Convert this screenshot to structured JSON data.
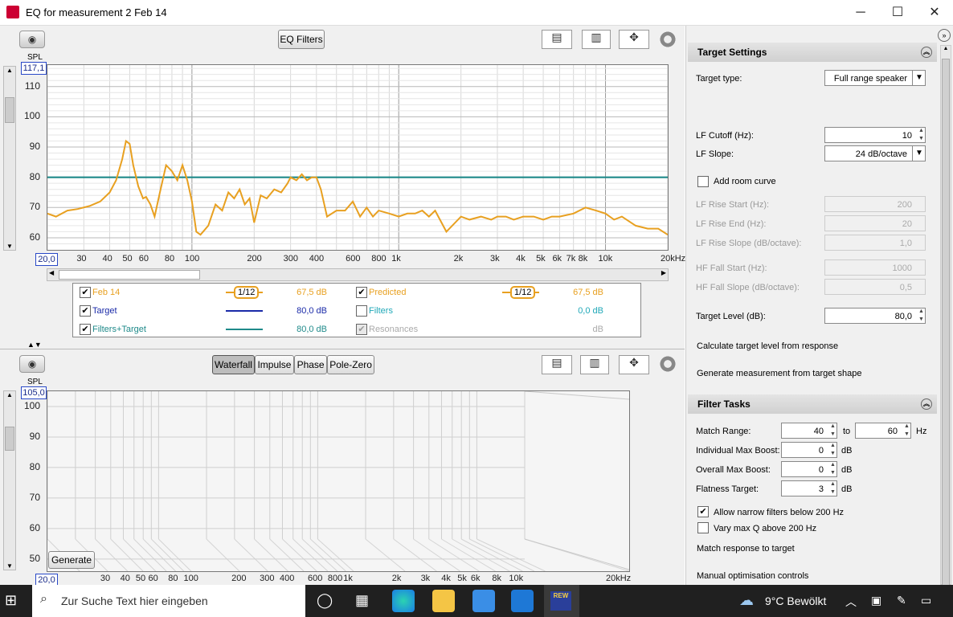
{
  "window": {
    "title": "EQ for measurement 2 Feb 14",
    "minimize": "─",
    "maximize": "☐",
    "close": "✕"
  },
  "top_graph": {
    "eq_filters_label": "EQ Filters",
    "axis_unit": "SPL",
    "y_top_value": "117,1",
    "x_left_value": "20,0",
    "y_ticks": [
      "110",
      "100",
      "90",
      "80",
      "70",
      "60"
    ],
    "x_ticks": [
      "30",
      "40",
      "50",
      "60",
      "80",
      "100",
      "200",
      "300",
      "400",
      "600",
      "800",
      "1k",
      "2k",
      "3k",
      "4k",
      "5k",
      "6k",
      "7k",
      "8k",
      "10k",
      "20kHz"
    ]
  },
  "legend": {
    "rows": [
      {
        "name": "Feb 14",
        "smoothing": "1/12",
        "value": "67,5 dB",
        "checked": true,
        "color": "#e8a020"
      },
      {
        "name": "Target",
        "value": "80,0 dB",
        "checked": true,
        "color": "#1a2aa8"
      },
      {
        "name": "Filters+Target",
        "value": "80,0 dB",
        "checked": true,
        "color": "#1f8a8a"
      }
    ],
    "rows_right": [
      {
        "name": "Predicted",
        "smoothing": "1/12",
        "value": "67,5 dB",
        "checked": true,
        "color": "#e8a020"
      },
      {
        "name": "Filters",
        "value": "0,0 dB",
        "checked": false,
        "color": "#20a8b8"
      },
      {
        "name": "Resonances",
        "value": "dB",
        "checked": true,
        "color": "#aaaaaa"
      }
    ]
  },
  "bottom_graph": {
    "tabs": [
      "Waterfall",
      "Impulse",
      "Phase",
      "Pole-Zero"
    ],
    "active_tab": "Waterfall",
    "axis_unit": "SPL",
    "y_top_value": "105,0",
    "x_left_value": "20,0",
    "y_ticks": [
      "100",
      "90",
      "80",
      "70",
      "60",
      "50"
    ],
    "x_ticks": [
      "30",
      "40",
      "50",
      "60",
      "80",
      "100",
      "200",
      "300",
      "400",
      "600",
      "800",
      "1k",
      "2k",
      "3k",
      "4k",
      "5k",
      "6k",
      "8k",
      "10k",
      "20kHz"
    ],
    "generate_label": "Generate"
  },
  "target_settings": {
    "title": "Target Settings",
    "target_type_label": "Target type:",
    "target_type_value": "Full range speaker",
    "lf_cutoff_label": "LF Cutoff (Hz):",
    "lf_cutoff_value": "10",
    "lf_slope_label": "LF Slope:",
    "lf_slope_value": "24 dB/octave",
    "add_room_curve_label": "Add room curve",
    "lf_rise_start_label": "LF Rise Start (Hz):",
    "lf_rise_start_value": "200",
    "lf_rise_end_label": "LF Rise End (Hz):",
    "lf_rise_end_value": "20",
    "lf_rise_slope_label": "LF Rise Slope (dB/octave):",
    "lf_rise_slope_value": "1,0",
    "hf_fall_start_label": "HF Fall Start (Hz):",
    "hf_fall_start_value": "1000",
    "hf_fall_slope_label": "HF Fall Slope (dB/octave):",
    "hf_fall_slope_value": "0,5",
    "target_level_label": "Target Level (dB):",
    "target_level_value": "80,0",
    "calc_target_label": "Calculate target level from response",
    "generate_meas_label": "Generate measurement from target shape"
  },
  "filter_tasks": {
    "title": "Filter Tasks",
    "match_range_label": "Match Range:",
    "match_from": "40",
    "to_label": "to",
    "match_to": "60",
    "hz_label": "Hz",
    "ind_boost_label": "Individual Max Boost:",
    "ind_boost_value": "0",
    "overall_boost_label": "Overall Max Boost:",
    "overall_boost_value": "0",
    "flatness_label": "Flatness Target:",
    "flatness_value": "3",
    "db_label": "dB",
    "allow_narrow_label": "Allow narrow filters below 200 Hz",
    "vary_q_label": "Vary max Q above 200 Hz",
    "match_response_label": "Match response to target",
    "manual_opt_label": "Manual optimisation controls"
  },
  "taskbar": {
    "search_placeholder": "Zur Suche Text hier eingeben",
    "weather": "9°C  Bewölkt",
    "rew_label": "REW"
  },
  "chart_data": {
    "type": "line",
    "xscale": "log",
    "xlim": [
      20,
      20000
    ],
    "ylim": [
      56,
      117.1
    ],
    "series": [
      {
        "name": "Target",
        "color": "#1f8a8a",
        "x": [
          20,
          20000
        ],
        "y": [
          80,
          80
        ]
      },
      {
        "name": "Predicted",
        "color": "#e8a020",
        "x": [
          20,
          22,
          25,
          28,
          32,
          36,
          40,
          43,
          46,
          48,
          50,
          52,
          55,
          58,
          60,
          63,
          66,
          70,
          75,
          80,
          85,
          90,
          95,
          100,
          105,
          110,
          120,
          130,
          140,
          150,
          160,
          170,
          180,
          190,
          200,
          215,
          230,
          250,
          270,
          290,
          300,
          320,
          340,
          360,
          380,
          400,
          420,
          450,
          500,
          550,
          600,
          650,
          700,
          750,
          800,
          900,
          1000,
          1100,
          1200,
          1300,
          1400,
          1500,
          1700,
          2000,
          2200,
          2500,
          2800,
          3000,
          3300,
          3600,
          4000,
          4500,
          5000,
          5500,
          6000,
          7000,
          8000,
          9000,
          10000,
          11000,
          12000,
          14000,
          16000,
          18000,
          20000
        ],
        "y": [
          68,
          67,
          69,
          69.5,
          70.5,
          72,
          75,
          79,
          86,
          92,
          91,
          84,
          77,
          73,
          73.5,
          71,
          67,
          75,
          84,
          82,
          79,
          84,
          79,
          72,
          62,
          61,
          64,
          71,
          69,
          75,
          73,
          76,
          71,
          73,
          65,
          74,
          73,
          76,
          75,
          78,
          80,
          79,
          81,
          79,
          80,
          80,
          76,
          67,
          69,
          69,
          72,
          67,
          70,
          67,
          69,
          68,
          67,
          68,
          68,
          69,
          67,
          69,
          62,
          67,
          66,
          67,
          66,
          67,
          67,
          66,
          67,
          67,
          66,
          67,
          67,
          68,
          70,
          69,
          68,
          66,
          67,
          64,
          63,
          63,
          61
        ]
      }
    ]
  }
}
